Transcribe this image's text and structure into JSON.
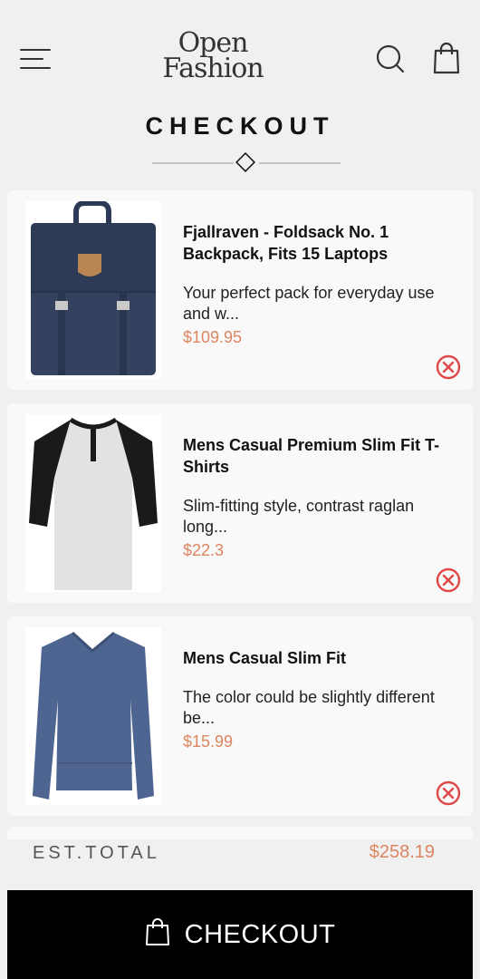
{
  "header": {
    "logo_line1": "Open",
    "logo_line2": "Fashion",
    "menu_icon": "menu-icon",
    "search_icon": "search-icon",
    "bag_icon": "shopping-bag-icon"
  },
  "page_title": "CHECKOUT",
  "colors": {
    "accent": "#dd8560",
    "remove": "#e04848",
    "button_bg": "#000000"
  },
  "cart": {
    "items": [
      {
        "name": "Fjallraven - Foldsack No. 1 Backpack, Fits 15 Laptops",
        "description": "Your perfect pack for everyday use and w...",
        "price": "$109.95",
        "image": "navy-backpack"
      },
      {
        "name": "Mens Casual Premium Slim Fit T-Shirts",
        "description": "Slim-fitting style, contrast raglan long...",
        "price": "$22.3",
        "image": "raglan-henley-shirt"
      },
      {
        "name": "Mens Casual Slim Fit",
        "description": "The color could be slightly different be...",
        "price": "$15.99",
        "image": "blue-long-sleeve-shirt"
      }
    ]
  },
  "total": {
    "label": "EST.TOTAL",
    "value": "$258.19"
  },
  "checkout_button": {
    "label": "CHECKOUT",
    "icon": "shopping-bag-icon"
  }
}
